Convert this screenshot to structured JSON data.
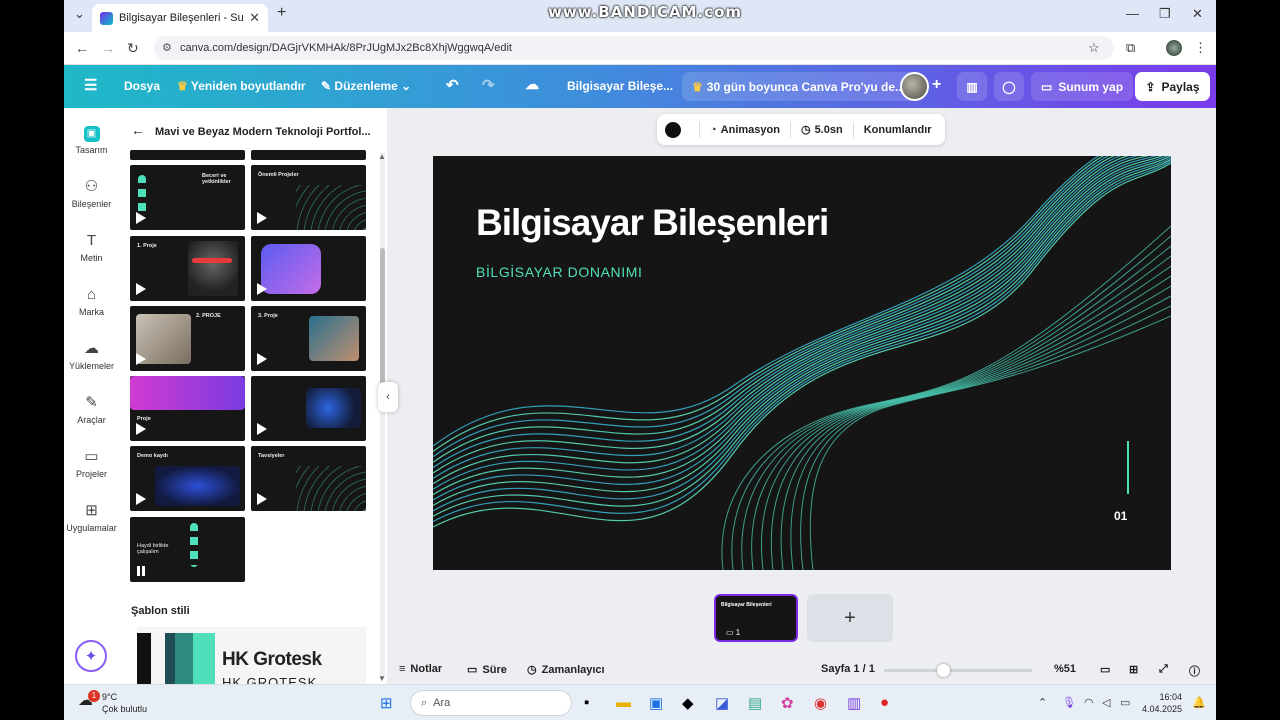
{
  "recorder_watermark": "www.BANDICAM.com",
  "browser": {
    "tab_title": "Bilgisayar Bileşenleri - Sunum",
    "url": "canva.com/design/DAGjrVKMHAk/8PrJUgMJx2Bc8XhjWggwqA/edit"
  },
  "toolbar": {
    "file": "Dosya",
    "resize": "Yeniden boyutlandır",
    "edit": "Düzenleme",
    "doc_title": "Bilgisayar Bileşe...",
    "promo": "30 gün boyunca Canva Pro'yu de...",
    "present": "Sunum yap",
    "share": "Paylaş"
  },
  "rail": {
    "items": [
      {
        "label": "Tasarım",
        "icon": "design-icon"
      },
      {
        "label": "Bileşenler",
        "icon": "elements-icon"
      },
      {
        "label": "Metin",
        "icon": "text-icon"
      },
      {
        "label": "Marka",
        "icon": "brand-icon"
      },
      {
        "label": "Yüklemeler",
        "icon": "upload-icon"
      },
      {
        "label": "Araçlar",
        "icon": "tools-icon"
      },
      {
        "label": "Projeler",
        "icon": "folder-icon"
      },
      {
        "label": "Uygulamalar",
        "icon": "apps-icon"
      }
    ]
  },
  "panel": {
    "title": "Mavi ve Beyaz Modern Teknoloji Portfol...",
    "thumbnails": [
      {
        "title": "Beceri ve yetkinlikler"
      },
      {
        "title": "Önemli Projeler"
      },
      {
        "title": "1. Proje"
      },
      {
        "title": ""
      },
      {
        "title": "2. PROJE"
      },
      {
        "title": "3. Proje"
      },
      {
        "title": "Proje"
      },
      {
        "title": ""
      },
      {
        "title": "Demo kaydı"
      },
      {
        "title": "Tavsiyeler"
      },
      {
        "title": "Haydi birlikte çalışalım"
      }
    ],
    "style_label": "Şablon stili",
    "font_name": "HK Grotesk",
    "font_name_caps": "HK GROTESK"
  },
  "context_bar": {
    "animation": "Animasyon",
    "duration": "5.0sn",
    "position": "Konumlandır"
  },
  "slide": {
    "title": "Bilgisayar Bileşenleri",
    "subtitle": "BİLGİSAYAR DONANIMI",
    "page_number": "01"
  },
  "filmstrip": {
    "thumb_title": "Bilgisayar Bileşenleri",
    "thumb_number": "1",
    "add": "+"
  },
  "footer": {
    "notes": "Notlar",
    "duration": "Süre",
    "timer": "Zamanlayıcı",
    "page": "Sayfa 1 / 1",
    "zoom": "%51",
    "zoom_level": 0.4
  },
  "taskbar": {
    "temp": "9°C",
    "weather": "Çok bulutlu",
    "notif_count": "1",
    "search": "Ara",
    "time": "16:04",
    "date": "4.04.2025"
  }
}
